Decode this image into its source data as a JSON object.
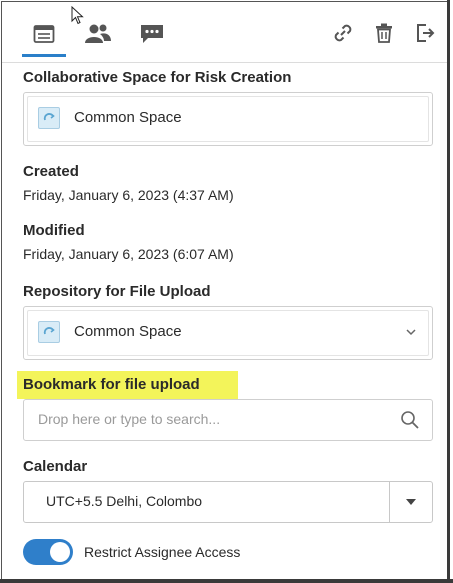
{
  "tabs": [
    {
      "icon": "properties-icon",
      "active": true
    },
    {
      "icon": "people-icon",
      "active": false
    },
    {
      "icon": "chat-icon",
      "active": false
    }
  ],
  "actions": [
    {
      "icon": "link-icon"
    },
    {
      "icon": "trash-icon"
    },
    {
      "icon": "exit-icon"
    }
  ],
  "collab": {
    "label": "Collaborative Space for Risk Creation",
    "value": "Common Space"
  },
  "created": {
    "label": "Created",
    "value": "Friday, January 6, 2023 (4:37 AM)"
  },
  "modified": {
    "label": "Modified",
    "value": "Friday, January 6, 2023 (6:07 AM)"
  },
  "repository": {
    "label": "Repository for File Upload",
    "value": "Common Space"
  },
  "bookmark": {
    "label": "Bookmark for file upload",
    "placeholder": "Drop here or type to search...",
    "highlight_color": "#f3f45a"
  },
  "calendar": {
    "label": "Calendar",
    "value": "UTC+5.5 Delhi, Colombo"
  },
  "restrict": {
    "label": "Restrict Assignee Access",
    "enabled": true
  },
  "colors": {
    "accent": "#2f7fca"
  }
}
